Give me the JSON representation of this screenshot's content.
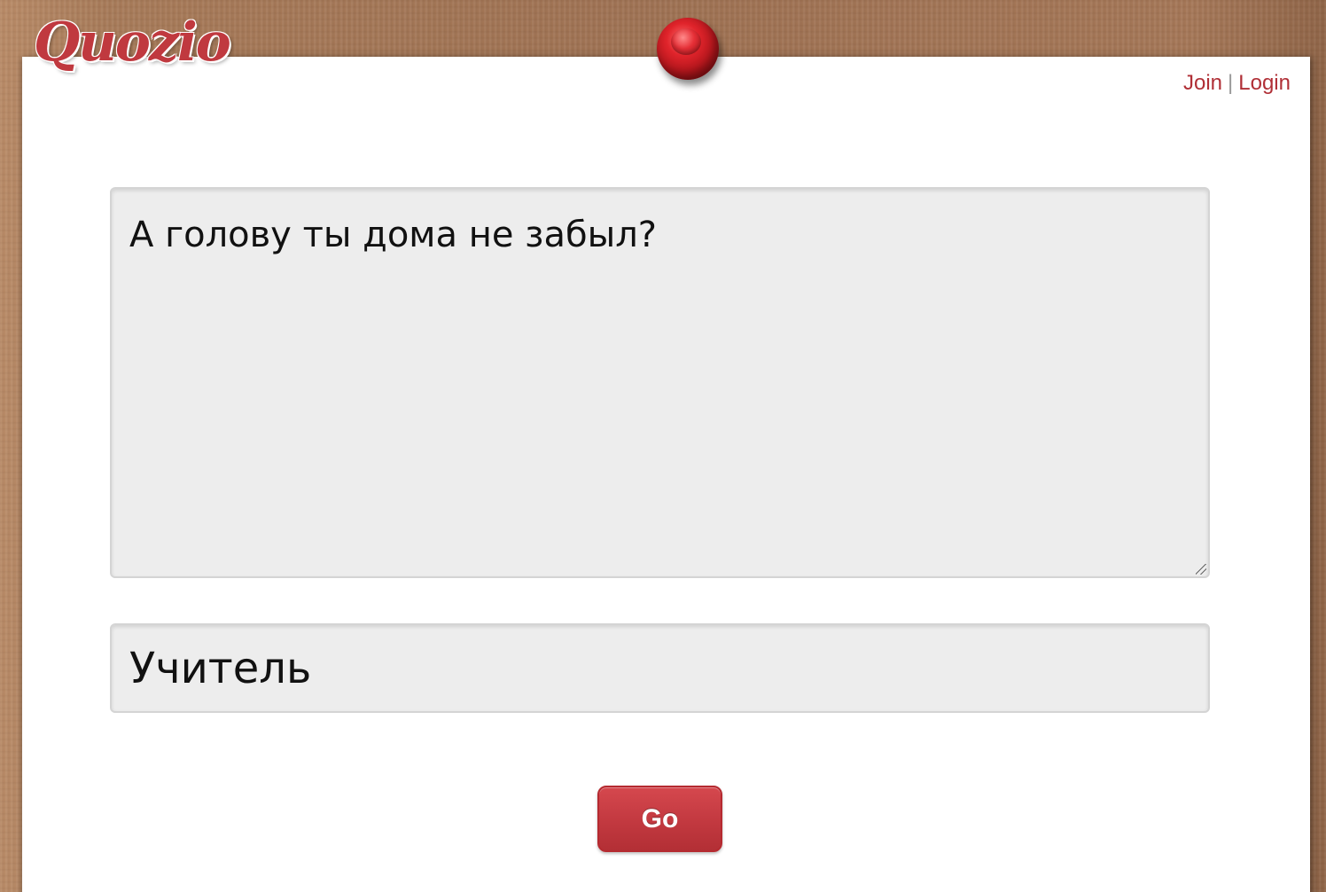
{
  "brand": {
    "logo_text": "Quozio"
  },
  "header": {
    "join_label": "Join",
    "separator": "|",
    "login_label": "Login"
  },
  "form": {
    "quote_value": "А голову ты дома не забыл?",
    "author_value": "Учитель",
    "submit_label": "Go"
  },
  "colors": {
    "accent": "#c0393f",
    "link": "#b02f36",
    "field_bg": "#ededed",
    "board": "#a47656"
  },
  "icons": {
    "pin": "pushpin-icon",
    "resize": "resize-grip-icon"
  }
}
